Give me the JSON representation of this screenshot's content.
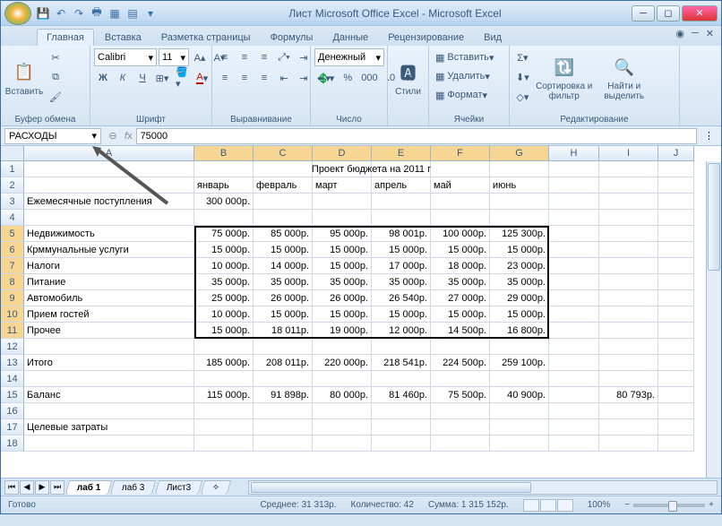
{
  "title": "Лист Microsoft Office Excel - Microsoft Excel",
  "tabs": [
    "Главная",
    "Вставка",
    "Разметка страницы",
    "Формулы",
    "Данные",
    "Рецензирование",
    "Вид"
  ],
  "ribbon": {
    "clipboard": {
      "paste": "Вставить",
      "label": "Буфер обмена"
    },
    "font": {
      "name": "Calibri",
      "size": "11",
      "label": "Шрифт"
    },
    "align": {
      "label": "Выравнивание"
    },
    "number": {
      "format": "Денежный",
      "label": "Число"
    },
    "styles": {
      "btn": "Стили",
      "label": ""
    },
    "cells": {
      "insert": "Вставить",
      "delete": "Удалить",
      "format": "Формат",
      "label": "Ячейки"
    },
    "editing": {
      "sort": "Сортировка и фильтр",
      "find": "Найти и выделить",
      "label": "Редактирование"
    }
  },
  "name_box": "РАСХОДЫ",
  "formula": "75000",
  "columns": [
    {
      "l": "A",
      "w": 190
    },
    {
      "l": "B",
      "w": 66
    },
    {
      "l": "C",
      "w": 66
    },
    {
      "l": "D",
      "w": 66
    },
    {
      "l": "E",
      "w": 66
    },
    {
      "l": "F",
      "w": 66
    },
    {
      "l": "G",
      "w": 66
    },
    {
      "l": "H",
      "w": 56
    },
    {
      "l": "I",
      "w": 66
    },
    {
      "l": "J",
      "w": 40
    }
  ],
  "rows_count": 18,
  "grid": {
    "title_merge": "Проект бюджета на 2011 г",
    "months": [
      "январь",
      "февраль",
      "март",
      "апрель",
      "май",
      "июнь"
    ],
    "r3a": "Ежемесячные поступления",
    "r3b": "300 000р.",
    "labels": [
      "Недвижимость",
      "Крммунальные услуги",
      "Налоги",
      "Питание",
      "Автомобиль",
      "Прием гостей",
      "Прочее"
    ],
    "data": [
      [
        "75 000р.",
        "85 000р.",
        "95 000р.",
        "98 001р.",
        "100 000р.",
        "125 300р."
      ],
      [
        "15 000р.",
        "15 000р.",
        "15 000р.",
        "15 000р.",
        "15 000р.",
        "15 000р."
      ],
      [
        "10 000р.",
        "14 000р.",
        "15 000р.",
        "17 000р.",
        "18 000р.",
        "23 000р."
      ],
      [
        "35 000р.",
        "35 000р.",
        "35 000р.",
        "35 000р.",
        "35 000р.",
        "35 000р."
      ],
      [
        "25 000р.",
        "26 000р.",
        "26 000р.",
        "26 540р.",
        "27 000р.",
        "29 000р."
      ],
      [
        "10 000р.",
        "15 000р.",
        "15 000р.",
        "15 000р.",
        "15 000р.",
        "15 000р."
      ],
      [
        "15 000р.",
        "18 011р.",
        "19 000р.",
        "12 000р.",
        "14 500р.",
        "16 800р."
      ]
    ],
    "r13a": "Итого",
    "r13": [
      "185 000р.",
      "208 011р.",
      "220 000р.",
      "218 541р.",
      "224 500р.",
      "259 100р."
    ],
    "r15a": "Баланс",
    "r15": [
      "115 000р.",
      "91 898р.",
      "80 000р.",
      "81 460р.",
      "75 500р.",
      "40 900р."
    ],
    "r15i": "80 793р.",
    "r17a": "Целевые затраты"
  },
  "sheets": [
    "лаб 1",
    "лаб 3",
    "Лист3"
  ],
  "status": {
    "ready": "Готово",
    "avg": "Среднее: 31 313р.",
    "count": "Количество: 42",
    "sum": "Сумма: 1 315 152р.",
    "zoom": "100%"
  }
}
